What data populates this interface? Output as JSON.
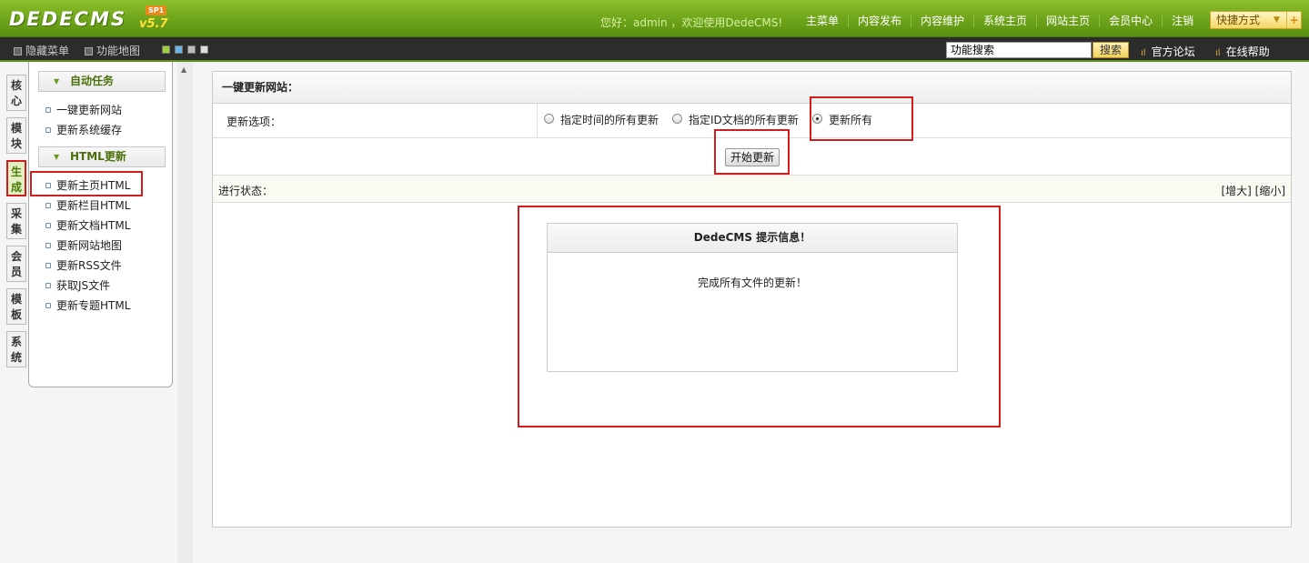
{
  "header": {
    "logo": "DEDECMS",
    "version": "v5.7",
    "sp": "SP1",
    "greeting": "您好：admin ，欢迎使用DedeCMS!",
    "nav": [
      "主菜单",
      "内容发布",
      "内容维护",
      "系统主页",
      "网站主页",
      "会员中心",
      "注销"
    ],
    "quick": "快捷方式",
    "quick_arrow": "▼",
    "quick_plus": "+"
  },
  "subbar": {
    "hide_menu": "隐藏菜单",
    "func_map": "功能地图",
    "search_value": "功能搜索",
    "search_button": "搜索",
    "forum": "官方论坛",
    "help": "在线帮助",
    "signal_glyph": "ıl",
    "swatch_colors": [
      "#9fd23a",
      "#6ab4e8",
      "#bbbbbb",
      "#dddddd"
    ]
  },
  "vtabs": [
    "核心",
    "模块",
    "生成",
    "采集",
    "会员",
    "模板",
    "系统"
  ],
  "leftmenu": {
    "group1": {
      "title": "自动任务",
      "items": [
        "一键更新网站",
        "更新系统缓存"
      ]
    },
    "group2": {
      "title": "HTML更新",
      "items": [
        "更新主页HTML",
        "更新栏目HTML",
        "更新文档HTML",
        "更新网站地图",
        "更新RSS文件",
        "获取JS文件",
        "更新专题HTML"
      ]
    }
  },
  "main": {
    "title": "一键更新网站：",
    "options_label": "更新选项：",
    "options": [
      "指定时间的所有更新",
      "指定ID文档的所有更新",
      "更新所有"
    ],
    "start_button": "开始更新",
    "status_label": "进行状态：",
    "zoom": "[增大] [缩小]",
    "message_title": "DedeCMS 提示信息！",
    "message_body": "完成所有文件的更新！"
  }
}
